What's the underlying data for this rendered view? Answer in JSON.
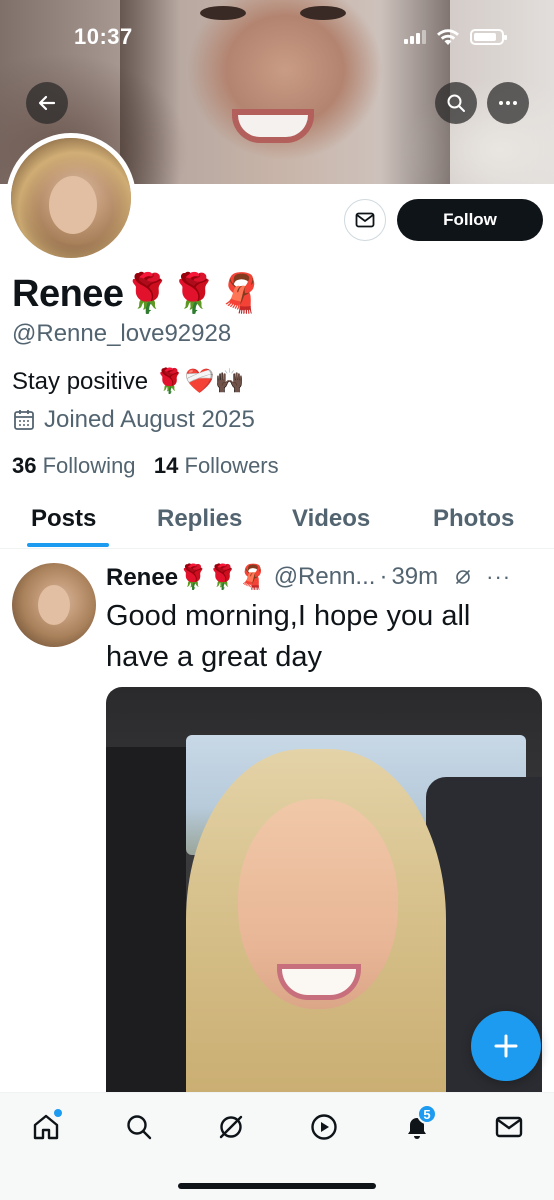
{
  "status_bar": {
    "time": "10:37"
  },
  "profile": {
    "name": "Renee🌹🌹🧣",
    "handle": "@Renne_love92928",
    "bio": "Stay positive 🌹❤️‍🩹🙌🏿",
    "joined": "Joined August 2025",
    "following_count": "36",
    "following_label": "Following",
    "followers_count": "14",
    "followers_label": "Followers",
    "follow_button": "Follow"
  },
  "tabs": [
    {
      "label": "Posts",
      "active": true
    },
    {
      "label": "Replies",
      "active": false
    },
    {
      "label": "Videos",
      "active": false
    },
    {
      "label": "Photos",
      "active": false
    }
  ],
  "post": {
    "author_name": "Renee🌹🌹🧣",
    "author_handle": "@Renn...",
    "separator": "·",
    "time": "39m",
    "text": "Good morning,I hope you all have a great day"
  },
  "bottom_nav": {
    "items": [
      "home-icon",
      "search-icon",
      "grok-icon",
      "video-icon",
      "notifications-icon",
      "messages-icon"
    ],
    "notifications_badge": "5"
  },
  "colors": {
    "accent": "#1d9bf0",
    "text": "#0f1419",
    "secondary": "#536471"
  }
}
